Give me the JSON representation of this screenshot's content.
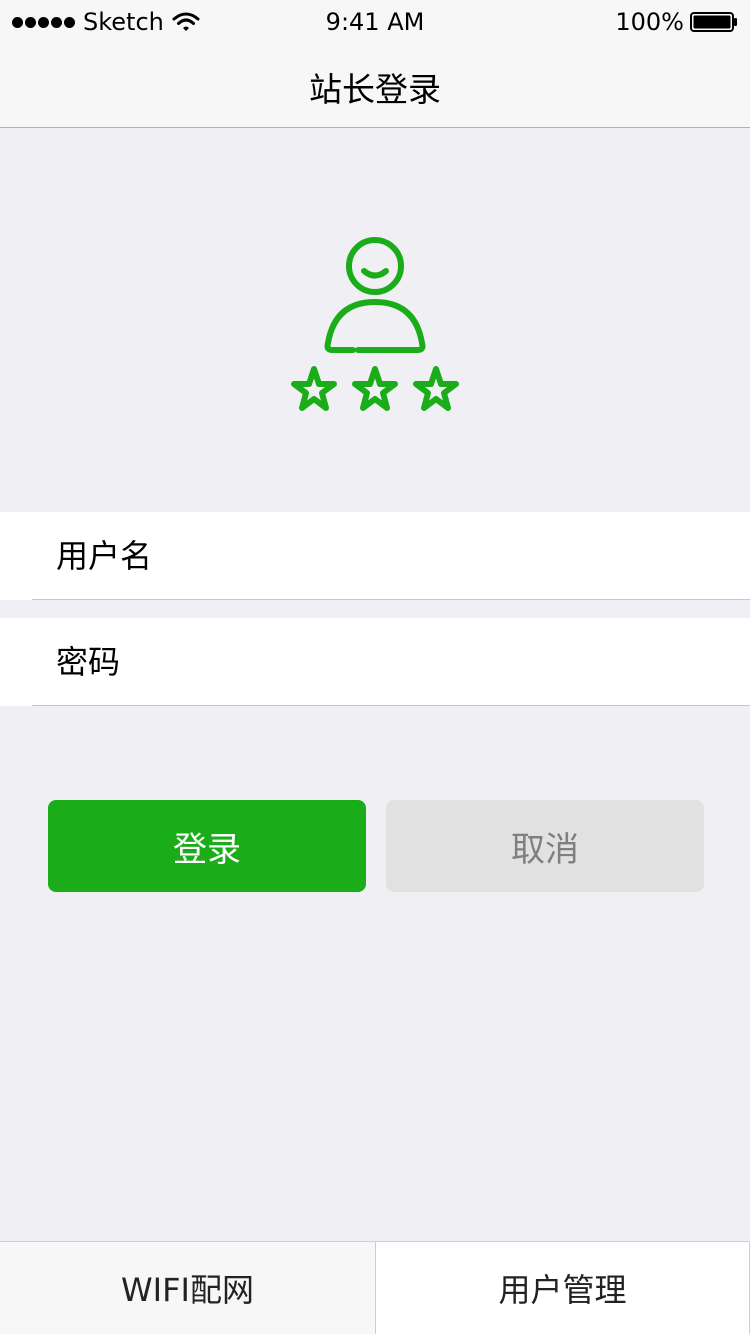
{
  "status_bar": {
    "carrier": "Sketch",
    "time": "9:41 AM",
    "battery": "100%",
    "battery_level": 1.0
  },
  "nav": {
    "title": "站长登录"
  },
  "hero": {
    "icon": "webmaster-user-stars-icon",
    "color": "#1aad19",
    "stars": 3
  },
  "form": {
    "username_placeholder": "用户名",
    "password_placeholder": "密码"
  },
  "buttons": {
    "login_label": "登录",
    "cancel_label": "取消"
  },
  "tabs": [
    {
      "label": "WIFI配网",
      "selected": false
    },
    {
      "label": "用户管理",
      "selected": true
    }
  ],
  "colors": {
    "accent": "#1aad19",
    "background": "#efeff4",
    "cancel_bg": "#e1e1e1"
  }
}
